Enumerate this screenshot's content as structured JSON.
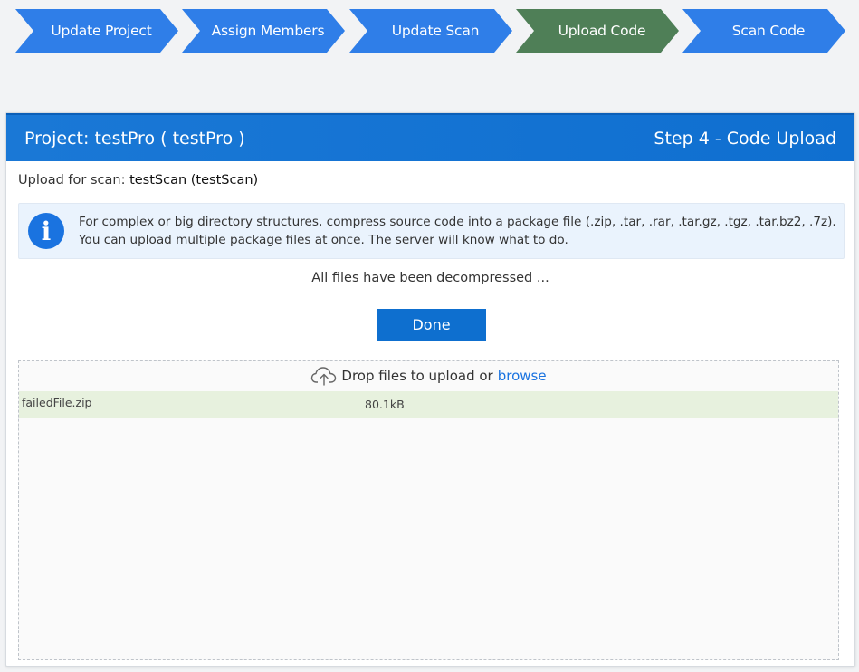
{
  "wizard": {
    "steps": [
      {
        "label": "Update Project"
      },
      {
        "label": "Assign Members"
      },
      {
        "label": "Update Scan"
      },
      {
        "label": "Upload Code"
      },
      {
        "label": "Scan Code"
      }
    ],
    "active_color": "#4f7f57",
    "default_color": "#2f7ee8"
  },
  "panel": {
    "title": "Project: testPro ( testPro )",
    "step_label": "Step 4 - Code Upload",
    "upload_for_label": "Upload for scan:",
    "scan_name": "testScan (testScan)",
    "info_icon": "info-circle-icon",
    "info_text_line1": "For complex or big directory structures, compress source code into a package file (.zip, .tar, .rar, .tar.gz, .tgz, .tar.bz2, .7z).",
    "info_text_line2": "You can upload multiple package files at once. The server will know what to do.",
    "status_text": "All files have been decompressed ...",
    "done_label": "Done"
  },
  "dropzone": {
    "icon": "cloud-upload-icon",
    "prompt": "Drop files to upload or",
    "browse_label": "browse",
    "files": [
      {
        "name": "failedFile.zip",
        "size": "80.1kB"
      }
    ]
  }
}
